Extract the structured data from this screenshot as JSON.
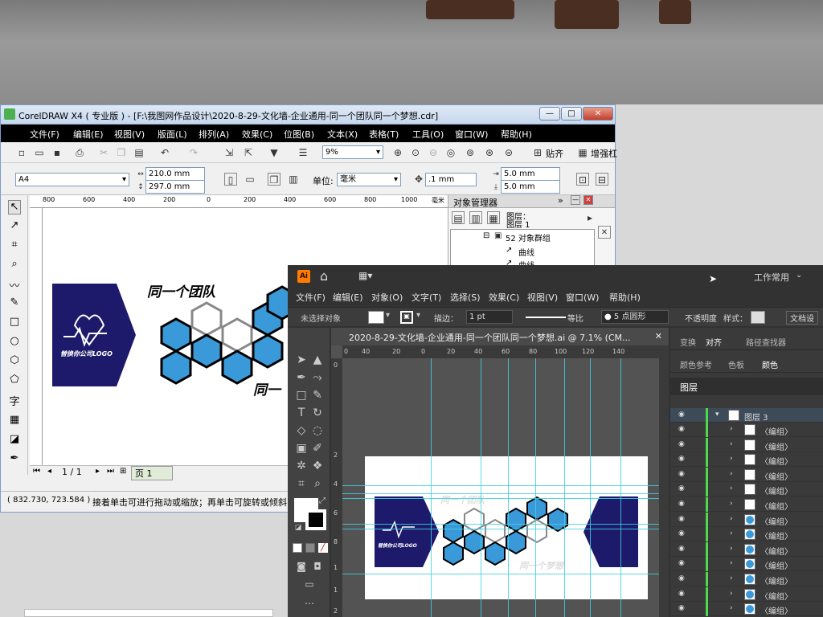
{
  "coreldraw": {
    "title": "CorelDRAW X4 ( 专业版 ) - [F:\\我图网作品设计\\2020-8-29-文化墙-企业通用-同一个团队同一个梦想.cdr]",
    "window_buttons": [
      "—",
      "□",
      "✕"
    ],
    "menu": [
      "文件(F)",
      "编辑(E)",
      "视图(V)",
      "版面(L)",
      "排列(A)",
      "效果(C)",
      "位图(B)",
      "文本(X)",
      "表格(T)",
      "工具(O)",
      "窗口(W)",
      "帮助(H)"
    ],
    "zoom": "9%",
    "snap_label": "贴齐",
    "paste_label": "增强杠",
    "page_size": "A4",
    "width": "210.0 mm",
    "height": "297.0 mm",
    "unit_label": "单位:",
    "unit_value": "毫米",
    "nudge": ".1 mm",
    "dup_x": "5.0 mm",
    "dup_y": "5.0 mm",
    "ruler_ticks": [
      "800",
      "600",
      "400",
      "200",
      "0",
      "200",
      "400",
      "600",
      "800",
      "1000"
    ],
    "ruler_unit": "毫米",
    "page_counter": "1 / 1",
    "page_tab": "页 1",
    "coords": "( 832.730, 723.584 )",
    "status_hint": "接着单击可进行拖动或缩放；再单击可旋转或倾斜；",
    "docker": {
      "title": "对象管理器",
      "layer_line1": "图层：",
      "layer_line2": "图层 1",
      "group_label": "52 对象群组",
      "items": [
        "曲线",
        "曲线"
      ]
    },
    "design": {
      "headline_top": "同一个团队",
      "headline_bottom": "同一",
      "company": "替换你公司LOGO"
    }
  },
  "illustrator": {
    "app_badge": "Ai",
    "workspace": "工作常用",
    "menu": [
      "文件(F)",
      "编辑(E)",
      "对象(O)",
      "文字(T)",
      "选择(S)",
      "效果(C)",
      "视图(V)",
      "窗口(W)",
      "帮助(H)"
    ],
    "control": {
      "no_selection": "未选择对象",
      "stroke_label": "描边：",
      "stroke_value": "1 pt",
      "profile": "等比",
      "brush": "5 点圆形",
      "opacity_label": "不透明度",
      "style_label": "样式：",
      "doc_setup": "文档设"
    },
    "doc_tab": "2020-8-29-文化墙-企业通用-同一个团队同一个梦想.ai @ 7.1% (CM...",
    "ruler_ticks": [
      "0",
      "40",
      "20",
      "0",
      "20",
      "40",
      "60",
      "80",
      "100",
      "120",
      "140"
    ],
    "ruler_v_ticks": [
      "0",
      "2",
      "4",
      "6",
      "8",
      "1",
      "1",
      "2"
    ],
    "panel_tabs_row1": [
      "变换",
      "对齐",
      "路径查找器"
    ],
    "panel_tabs_row2": [
      "颜色参考",
      "色板",
      "颜色"
    ],
    "layers_tab": "图层",
    "layer_name": "图层 3",
    "layer_items": [
      "〈编组〉",
      "〈编组〉",
      "〈编组〉",
      "〈编组〉",
      "〈编组〉",
      "〈编组〉",
      "〈编组〉",
      "〈编组〉",
      "〈编组〉",
      "〈编组〉",
      "〈编组〉",
      "〈编组〉",
      "〈编组〉"
    ],
    "design": {
      "headline_top": "同一个团队",
      "headline_bottom": "同一个梦想",
      "company": "替换你公司LOGO"
    }
  },
  "colors": {
    "navy": "#1e1a6b",
    "hex_blue": "#3a9ad9",
    "guide": "#3fd0e0"
  }
}
